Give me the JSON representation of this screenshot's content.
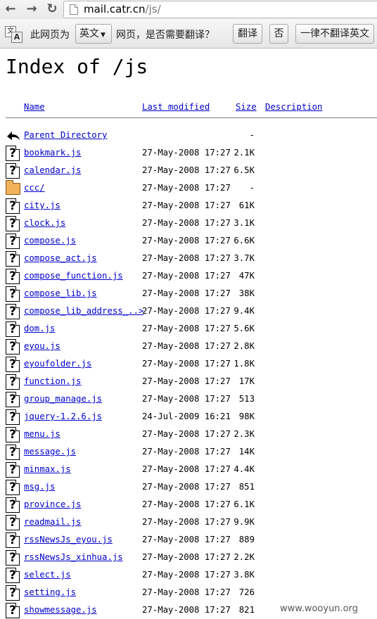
{
  "browser": {
    "url_host": "mail.catr.cn",
    "url_path": "/js/"
  },
  "translate_bar": {
    "icon_text_1": "文",
    "icon_text_2": "A",
    "prefix": "此网页为",
    "language": "英文",
    "suffix": "网页，是否需要翻译？",
    "translate_button": "翻译",
    "no_button": "否",
    "never_button": "一律不翻译英文"
  },
  "page": {
    "title": "Index of /js",
    "columns": {
      "name": "Name",
      "last_modified": "Last modified",
      "size": "Size",
      "description": "Description"
    },
    "parent": {
      "name": "Parent Directory",
      "size": "-"
    },
    "entries": [
      {
        "icon": "unknown-file-icon",
        "name": "bookmark.js",
        "date": "27-May-2008 17:27",
        "size": "2.1K"
      },
      {
        "icon": "unknown-file-icon",
        "name": "calendar.js",
        "date": "27-May-2008 17:27",
        "size": "6.5K"
      },
      {
        "icon": "folder-icon",
        "name": "ccc/",
        "date": "27-May-2008 17:27",
        "size": "-"
      },
      {
        "icon": "unknown-file-icon",
        "name": "city.js",
        "date": "27-May-2008 17:27",
        "size": "61K"
      },
      {
        "icon": "unknown-file-icon",
        "name": "clock.js",
        "date": "27-May-2008 17:27",
        "size": "3.1K"
      },
      {
        "icon": "unknown-file-icon",
        "name": "compose.js",
        "date": "27-May-2008 17:27",
        "size": "6.6K"
      },
      {
        "icon": "unknown-file-icon",
        "name": "compose_act.js",
        "date": "27-May-2008 17:27",
        "size": "3.7K"
      },
      {
        "icon": "unknown-file-icon",
        "name": "compose_function.js",
        "date": "27-May-2008 17:27",
        "size": "47K"
      },
      {
        "icon": "unknown-file-icon",
        "name": "compose_lib.js",
        "date": "27-May-2008 17:27",
        "size": "38K"
      },
      {
        "icon": "unknown-file-icon",
        "name": "compose_lib_address_..>",
        "date": "27-May-2008 17:27",
        "size": "9.4K"
      },
      {
        "icon": "unknown-file-icon",
        "name": "dom.js",
        "date": "27-May-2008 17:27",
        "size": "5.6K"
      },
      {
        "icon": "unknown-file-icon",
        "name": "eyou.js",
        "date": "27-May-2008 17:27",
        "size": "2.8K"
      },
      {
        "icon": "unknown-file-icon",
        "name": "eyoufolder.js",
        "date": "27-May-2008 17:27",
        "size": "1.8K"
      },
      {
        "icon": "unknown-file-icon",
        "name": "function.js",
        "date": "27-May-2008 17:27",
        "size": "17K"
      },
      {
        "icon": "unknown-file-icon",
        "name": "group_manage.js",
        "date": "27-May-2008 17:27",
        "size": "513"
      },
      {
        "icon": "unknown-file-icon",
        "name": "jquery-1.2.6.js",
        "date": "24-Jul-2009 16:21",
        "size": "98K"
      },
      {
        "icon": "unknown-file-icon",
        "name": "menu.js",
        "date": "27-May-2008 17:27",
        "size": "2.3K"
      },
      {
        "icon": "unknown-file-icon",
        "name": "message.js",
        "date": "27-May-2008 17:27",
        "size": "14K"
      },
      {
        "icon": "unknown-file-icon",
        "name": "minmax.js",
        "date": "27-May-2008 17:27",
        "size": "4.4K"
      },
      {
        "icon": "unknown-file-icon",
        "name": "msg.js",
        "date": "27-May-2008 17:27",
        "size": "851"
      },
      {
        "icon": "unknown-file-icon",
        "name": "province.js",
        "date": "27-May-2008 17:27",
        "size": "6.1K"
      },
      {
        "icon": "unknown-file-icon",
        "name": "readmail.js",
        "date": "27-May-2008 17:27",
        "size": "9.9K"
      },
      {
        "icon": "unknown-file-icon",
        "name": "rssNewsJs_eyou.js",
        "date": "27-May-2008 17:27",
        "size": "889"
      },
      {
        "icon": "unknown-file-icon",
        "name": "rssNewsJs_xinhua.js",
        "date": "27-May-2008 17:27",
        "size": "2.2K"
      },
      {
        "icon": "unknown-file-icon",
        "name": "select.js",
        "date": "27-May-2008 17:27",
        "size": "3.8K"
      },
      {
        "icon": "unknown-file-icon",
        "name": "setting.js",
        "date": "27-May-2008 17:27",
        "size": "726"
      },
      {
        "icon": "unknown-file-icon",
        "name": "showmessage.js",
        "date": "27-May-2008 17:27",
        "size": "821"
      }
    ]
  },
  "watermark": "www.wooyun.org"
}
